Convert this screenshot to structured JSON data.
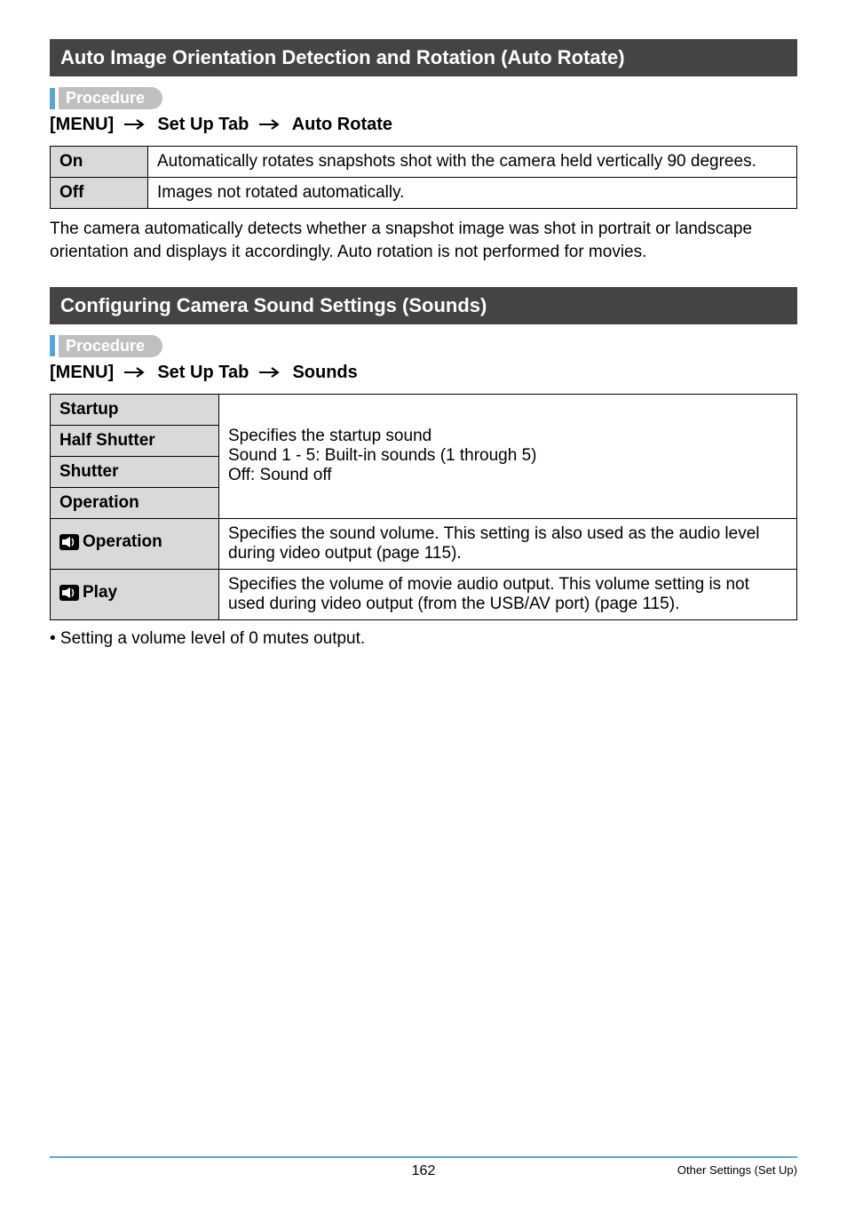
{
  "section1": {
    "title": "Auto Image Orientation Detection and Rotation (Auto Rotate)",
    "procedure_label": "Procedure",
    "menu_path": {
      "p1": "[MENU]",
      "p2": "Set Up Tab",
      "p3": "Auto Rotate"
    },
    "rows": [
      {
        "head": "On",
        "body": "Automatically rotates snapshots shot with the camera held vertically 90 degrees."
      },
      {
        "head": "Off",
        "body": "Images not rotated automatically."
      }
    ],
    "footnote": "The camera automatically detects whether a snapshot image was shot in portrait or landscape orientation and displays it accordingly. Auto rotation is not performed for movies."
  },
  "section2": {
    "title": "Configuring Camera Sound Settings (Sounds)",
    "procedure_label": "Procedure",
    "menu_path": {
      "p1": "[MENU]",
      "p2": "Set Up Tab",
      "p3": "Sounds"
    },
    "group_body": "Specifies the startup sound\nSound 1 - 5: Built-in sounds (1 through 5)\nOff: Sound off",
    "rows_group": [
      {
        "head": "Startup"
      },
      {
        "head": "Half Shutter"
      },
      {
        "head": "Shutter"
      },
      {
        "head": "Operation"
      }
    ],
    "row_op": {
      "head": "Operation",
      "body": "Specifies the sound volume. This setting is also used as the audio level during video output (page 115)."
    },
    "row_play": {
      "head": "Play",
      "body": "Specifies the volume of movie audio output. This volume setting is not used during video output (from the USB/AV port) (page 115)."
    },
    "bullet": "• Setting a volume level of 0 mutes output."
  },
  "footer": {
    "page": "162",
    "section": "Other Settings (Set Up)"
  },
  "icons": {
    "speaker": "speaker-icon",
    "arrow": "arrow-icon"
  }
}
